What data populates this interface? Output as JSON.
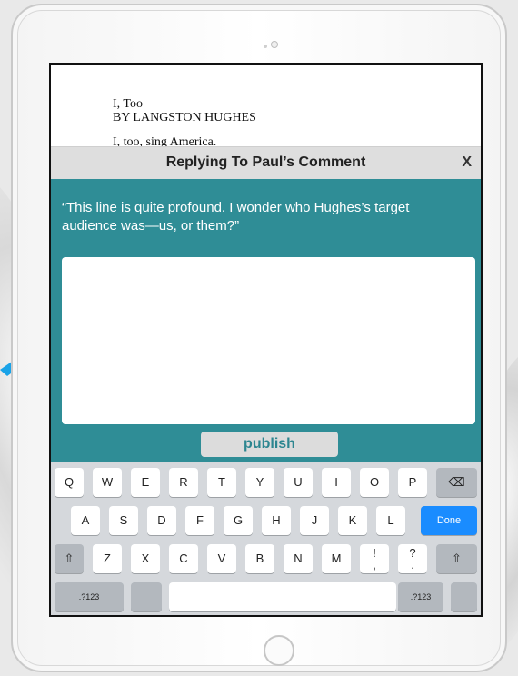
{
  "poem": {
    "title": "I, Too",
    "author": "BY LANGSTON HUGHES",
    "first_line": "I, too, sing America."
  },
  "modal": {
    "title": "Replying To Paul’s Comment",
    "close_label": "X",
    "quote": "“This line is quite profound. I wonder who Hughes’s target audience was—us, or them?”",
    "reply_value": "",
    "publish_label": "publish"
  },
  "keyboard": {
    "row1": [
      "Q",
      "W",
      "E",
      "R",
      "T",
      "Y",
      "U",
      "I",
      "O",
      "P"
    ],
    "row2": [
      "A",
      "S",
      "D",
      "F",
      "G",
      "H",
      "J",
      "K",
      "L"
    ],
    "row3": [
      "Z",
      "X",
      "C",
      "V",
      "B",
      "N",
      "M"
    ],
    "row3_punct": [
      "!\n,",
      "?\n."
    ],
    "backspace_icon": "⌫",
    "shift_icon": "⇧",
    "done_label": "Done",
    "numbers_label": ".?123"
  },
  "colors": {
    "accent": "#2f8d96",
    "done_key": "#1a8cff",
    "pointer_arrow": "#1aa3e8"
  },
  "icons": {
    "arrow": "pointer-arrow-icon",
    "close": "close-icon",
    "backspace": "backspace-icon",
    "shift": "shift-icon"
  }
}
